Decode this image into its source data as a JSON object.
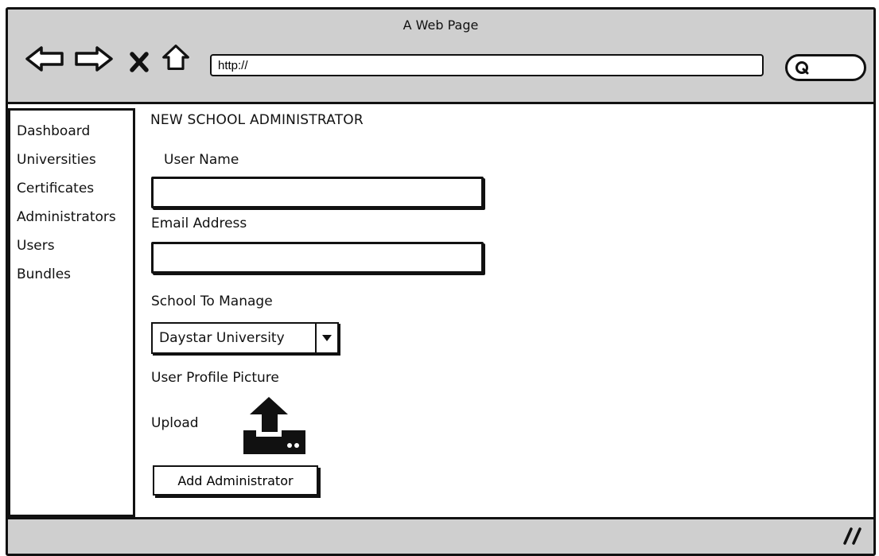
{
  "window": {
    "title": "A Web Page"
  },
  "toolbar": {
    "back_icon": "back-arrow-icon",
    "forward_icon": "forward-arrow-icon",
    "stop_icon": "close-icon",
    "home_icon": "home-icon",
    "address_value": "http://",
    "search_icon": "search-icon"
  },
  "sidebar": {
    "items": [
      {
        "label": "Dashboard"
      },
      {
        "label": "Universities"
      },
      {
        "label": "Certificates"
      },
      {
        "label": "Administrators"
      },
      {
        "label": "Users"
      },
      {
        "label": "Bundles"
      }
    ]
  },
  "form": {
    "title": "NEW SCHOOL ADMINISTRATOR",
    "username_label": "User Name",
    "username_value": "",
    "email_label": "Email Address",
    "email_value": "",
    "school_label": "School To Manage",
    "school_selected": "Daystar University",
    "picture_label": "User Profile Picture",
    "upload_label": "Upload",
    "upload_icon": "upload-icon",
    "submit_label": "Add Administrator"
  },
  "statusbar": {
    "grip_icon": "resize-grip-icon"
  }
}
